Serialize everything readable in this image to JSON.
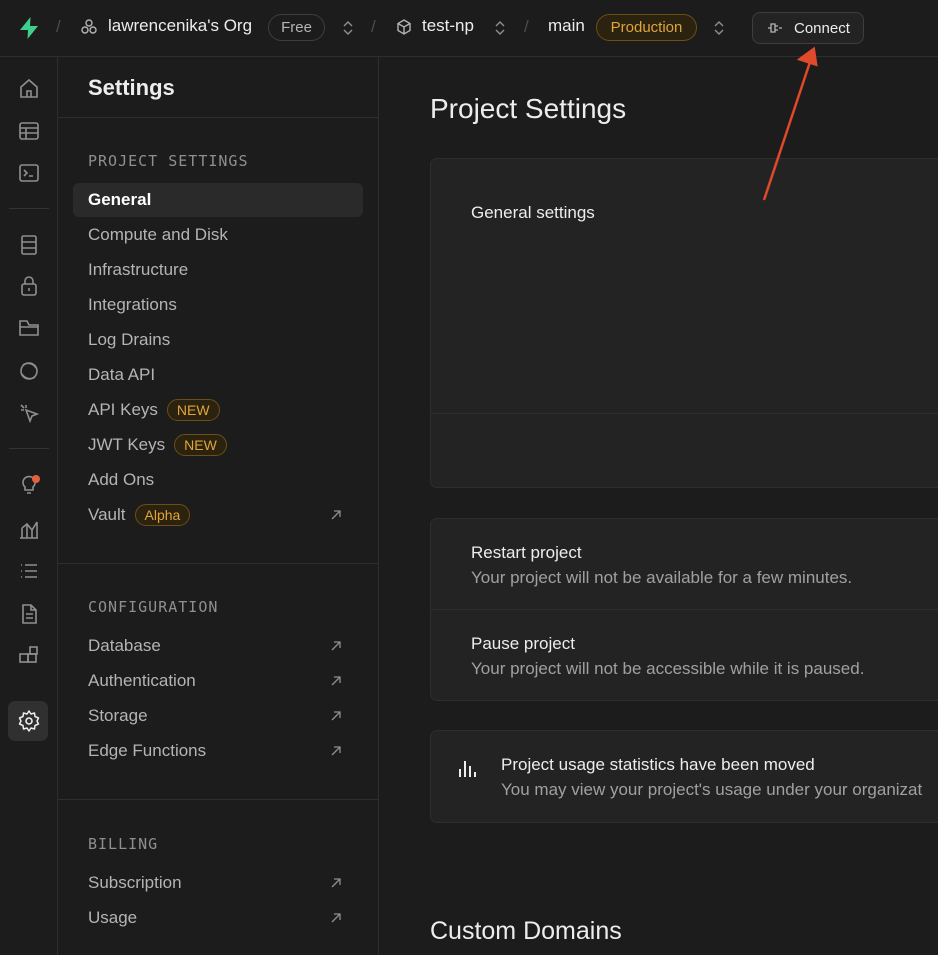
{
  "topbar": {
    "org_name": "lawrencenika's Org",
    "org_plan": "Free",
    "project_name": "test-np",
    "branch_name": "main",
    "branch_env": "Production",
    "connect_label": "Connect"
  },
  "rail": {
    "icons": [
      "home-icon",
      "table-editor-icon",
      "sql-editor-icon",
      "database-icon",
      "auth-lock-icon",
      "storage-folder-icon",
      "realtime-icon",
      "edge-functions-cursor-icon",
      "advisors-bulb-icon",
      "reports-chart-icon",
      "logs-list-icon",
      "api-docs-icon",
      "integrations-icon",
      "settings-gear-icon"
    ],
    "active": "settings-gear-icon",
    "accent_dot": "#e5603d"
  },
  "sidebar": {
    "title": "Settings",
    "project_settings": {
      "label": "PROJECT SETTINGS",
      "items": [
        {
          "label": "General"
        },
        {
          "label": "Compute and Disk"
        },
        {
          "label": "Infrastructure"
        },
        {
          "label": "Integrations"
        },
        {
          "label": "Log Drains"
        },
        {
          "label": "Data API"
        },
        {
          "label": "API Keys",
          "badge": "NEW"
        },
        {
          "label": "JWT Keys",
          "badge": "NEW"
        },
        {
          "label": "Add Ons"
        },
        {
          "label": "Vault",
          "badge": "Alpha"
        }
      ]
    },
    "configuration": {
      "label": "CONFIGURATION",
      "items": [
        {
          "label": "Database"
        },
        {
          "label": "Authentication"
        },
        {
          "label": "Storage"
        },
        {
          "label": "Edge Functions"
        }
      ]
    },
    "billing": {
      "label": "BILLING",
      "items": [
        {
          "label": "Subscription"
        },
        {
          "label": "Usage"
        }
      ]
    }
  },
  "main": {
    "title": "Project Settings",
    "general_card": {
      "label": "General settings"
    },
    "restart": {
      "label": "Restart project",
      "desc": "Your project will not be available for a few minutes."
    },
    "pause": {
      "label": "Pause project",
      "desc": "Your project will not be accessible while it is paused."
    },
    "usage_notice": {
      "label": "Project usage statistics have been moved",
      "desc": "You may view your project's usage under your organizat"
    },
    "custom_domains_title": "Custom Domains"
  },
  "colors": {
    "brand_green": "#3ecf8e",
    "warning_amber": "#e0a53a",
    "annotation_arrow": "#e04a2a"
  }
}
